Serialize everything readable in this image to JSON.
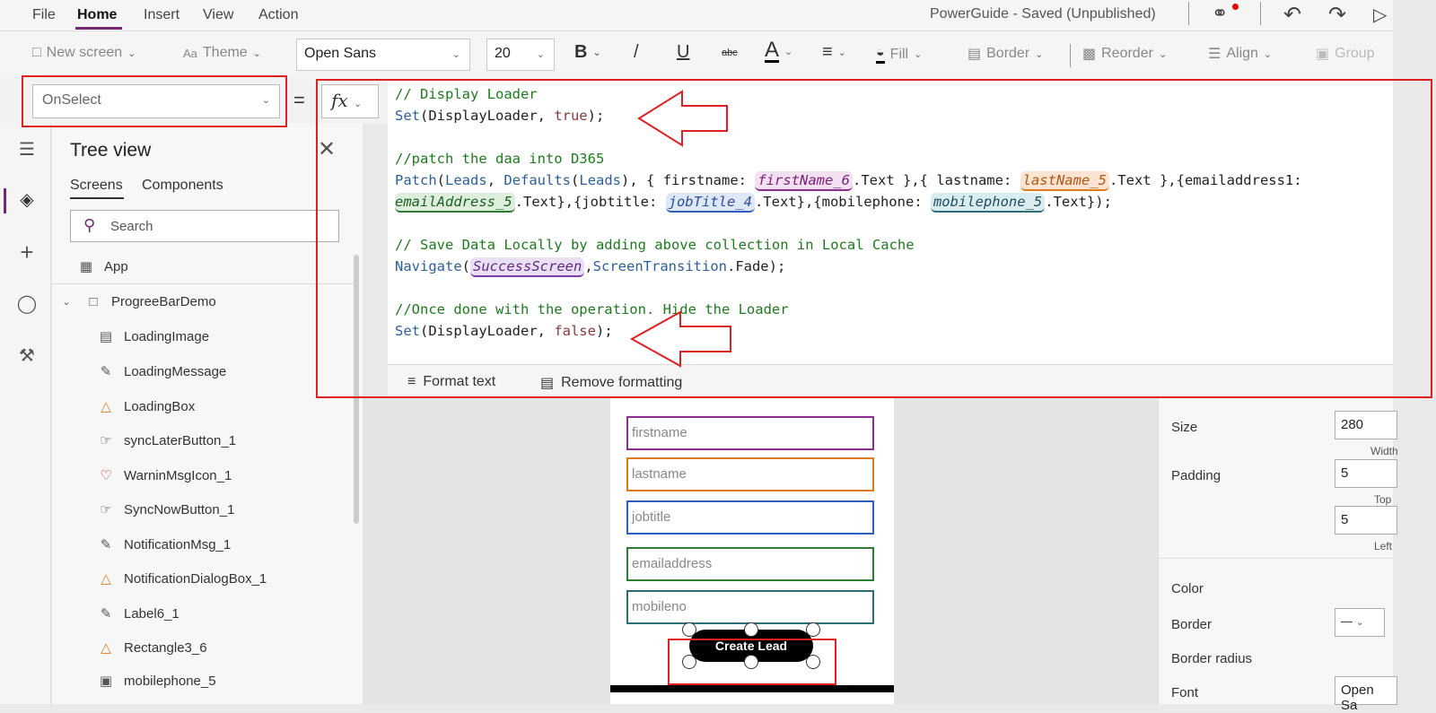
{
  "menubar": {
    "items": [
      "File",
      "Home",
      "Insert",
      "View",
      "Action"
    ],
    "active": "Home",
    "app_title": "PowerGuide - Saved (Unpublished)"
  },
  "toolbar": {
    "new_screen": "New screen",
    "theme": "Theme",
    "font": "Open Sans",
    "font_size": "20",
    "bold": "B",
    "italic": "/",
    "underline": "U",
    "strike": "abc",
    "font_color": "A",
    "fill": "Fill",
    "border": "Border",
    "reorder": "Reorder",
    "align": "Align",
    "group": "Group"
  },
  "formula": {
    "property": "OnSelect",
    "equals": "=",
    "fx": "fx",
    "lines": {
      "l1": "// Display Loader",
      "l2_fn": "Set",
      "l2_rest": "(DisplayLoader, ",
      "l2_kw": "true",
      "l2_end": ");",
      "l4": "//patch the daa into D365",
      "l5_a": "Patch",
      "l5_b": "(",
      "l5_c": "Leads",
      "l5_d": ", ",
      "l5_e": "Defaults",
      "l5_f": "(",
      "l5_g": "Leads",
      "l5_h": "), { firstname: ",
      "l5_tok1": "firstName_6",
      "l5_i": ".Text },{ lastname: ",
      "l5_tok2": "lastName_5",
      "l5_j": ".Text },{emailaddress1:",
      "l6_tok1": "emailAddress_5",
      "l6_a": ".Text},{jobtitle: ",
      "l6_tok2": "jobTitle_4",
      "l6_b": ".Text},{mobilephone: ",
      "l6_tok3": "mobilephone_5",
      "l6_c": ".Text});",
      "l8": "// Save Data Locally by adding above collection in Local Cache",
      "l9_fn": "Navigate",
      "l9_a": "(",
      "l9_tok": "SuccessScreen",
      "l9_b": ",",
      "l9_c": "ScreenTransition",
      "l9_d": ".Fade);",
      "l11": "//Once done with the operation. Hide the Loader",
      "l12_fn": "Set",
      "l12_rest": "(DisplayLoader, ",
      "l12_kw": "false",
      "l12_end": ");"
    },
    "format_text": "Format text",
    "remove_formatting": "Remove formatting"
  },
  "tree": {
    "title": "Tree view",
    "tabs": [
      "Screens",
      "Components"
    ],
    "search_placeholder": "Search",
    "app_label": "App",
    "screen_label": "ProgreeBarDemo",
    "items": [
      "LoadingImage",
      "LoadingMessage",
      "LoadingBox",
      "syncLaterButton_1",
      "WarninMsgIcon_1",
      "SyncNowButton_1",
      "NotificationMsg_1",
      "NotificationDialogBox_1",
      "Label6_1",
      "Rectangle3_6",
      "mobilephone_5"
    ]
  },
  "form": {
    "fields": [
      "firstname",
      "lastname",
      "jobtitle",
      "emailaddress",
      "mobileno"
    ],
    "field_colors": [
      "#8b2e8b",
      "#e07a1f",
      "#2f5fbf",
      "#2e7d32",
      "#2c6e78"
    ],
    "button": "Create Lead"
  },
  "properties": {
    "size_label": "Size",
    "size_value": "280",
    "width_label": "Width",
    "padding_label": "Padding",
    "padding_top": "5",
    "top_label": "Top",
    "padding_left": "5",
    "left_label": "Left",
    "color_label": "Color",
    "border_label": "Border",
    "border_radius_label": "Border radius",
    "font_label": "Font",
    "font_value": "Open Sa"
  },
  "colors": {
    "accent": "#742774",
    "annotation": "#e02020"
  }
}
